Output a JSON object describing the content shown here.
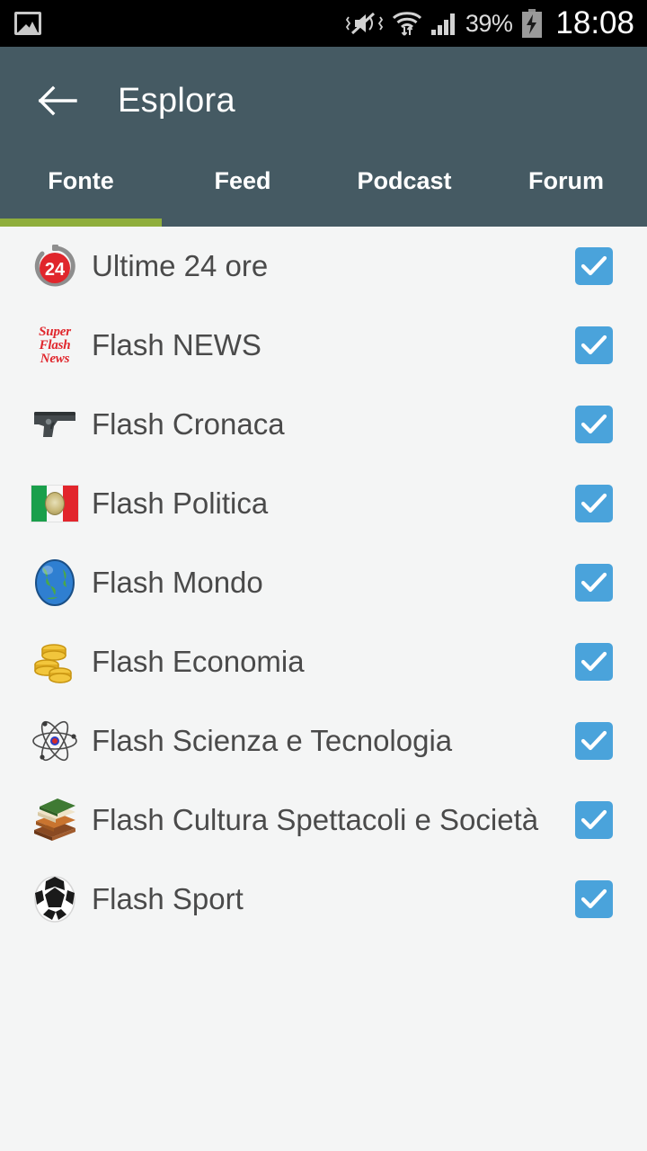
{
  "status_bar": {
    "notification_icon": "photo-icon",
    "icons": [
      "mute-vibrate-icon",
      "wifi-icon",
      "signal-bars-icon"
    ],
    "battery_percent": "39%",
    "battery_icon": "battery-charging-icon",
    "clock": "18:08"
  },
  "toolbar": {
    "back_icon": "back-arrow-icon",
    "title": "Esplora",
    "background": "#455a63"
  },
  "tabs": {
    "items": [
      {
        "label": "Fonte",
        "active": true
      },
      {
        "label": "Feed",
        "active": false
      },
      {
        "label": "Podcast",
        "active": false
      },
      {
        "label": "Forum",
        "active": false
      }
    ],
    "indicator_color": "#8fae3c"
  },
  "list": {
    "checkbox_color": "#4aa3db",
    "rows": [
      {
        "label": "Ultime 24 ore",
        "icon": "timer-24-icon",
        "checked": true
      },
      {
        "label": "Flash NEWS",
        "icon": "super-flash-news-logo",
        "checked": true
      },
      {
        "label": "Flash Cronaca",
        "icon": "pistol-icon",
        "checked": true
      },
      {
        "label": "Flash Politica",
        "icon": "italy-flag-icon",
        "checked": true
      },
      {
        "label": "Flash Mondo",
        "icon": "globe-icon",
        "checked": true
      },
      {
        "label": "Flash Economia",
        "icon": "coins-icon",
        "checked": true
      },
      {
        "label": "Flash Scienza e Tecnologia",
        "icon": "atom-icon",
        "checked": true
      },
      {
        "label": "Flash Cultura Spettacoli e Società",
        "icon": "books-icon",
        "checked": true
      },
      {
        "label": "Flash Sport",
        "icon": "soccer-ball-icon",
        "checked": true
      }
    ]
  },
  "flash_news_logo": {
    "line1": "Super",
    "line2": "Flash",
    "line3": "News"
  }
}
